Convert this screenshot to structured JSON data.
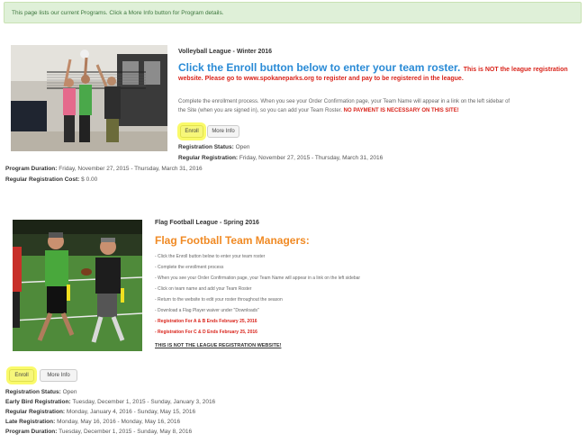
{
  "alert": "This page lists our current Programs. Click a More Info button for Program details.",
  "volleyball": {
    "title": "Volleyball League - Winter 2016",
    "headline": "Click the Enroll button below to enter your team roster.",
    "notice_part1": "This is NOT the league registration",
    "notice_part2": "website. Please go to www.spokaneparks.org to register and pay to be registered in the league.",
    "desc_line1": "Complete the enrollment process.  When you see your Order Confirmation page, your Team Name will appear in a link on the left sidebar of",
    "desc_line2": "the Site (when you are signed in), so you can add your Team Roster.",
    "desc_red": "NO PAYMENT IS NECESSARY ON THIS SITE!",
    "enroll_label": "Enroll",
    "more_info_label": "More Info",
    "status_label": "Registration Status:",
    "status_value": "Open",
    "regular_label": "Regular Registration:",
    "regular_value": "Friday, November 27, 2015 - Thursday, March 31, 2016",
    "duration_label": "Program Duration:",
    "duration_value": "Friday, November 27, 2015 - Thursday, March 31, 2016",
    "cost_label": "Regular Registration Cost:",
    "cost_value": "$ 0.00"
  },
  "flag": {
    "title": "Flag Football League - Spring 2016",
    "headline": "Flag Football Team Managers:",
    "bullets": [
      "- Click the Enroll button below to enter your team roster",
      "- Complete the enrollment process",
      "- When you see your Order Confirmation page, your Team Name will appear in a link on the left sidebar",
      "- Click on team name and add your Team Roster",
      "- Return to the website to edit your roster throughout the season",
      "- Download a Flag Player waiver under \"Downloads\""
    ],
    "red_bullets": [
      "- Registration For A & B Ends February 25, 2016",
      "- Registration For C & D Ends February 25, 2016"
    ],
    "not_site": "THIS IS NOT THE LEAGUE REGISTRATION WEBSITE!",
    "enroll_label": "Enroll",
    "more_info_label": "More Info",
    "status_label": "Registration Status:",
    "status_value": "Open",
    "early_label": "Early Bird Registration:",
    "early_value": "Tuesday, December 1, 2015 - Sunday, January 3, 2016",
    "regular_label": "Regular Registration:",
    "regular_value": "Monday, January 4, 2016 - Sunday, May 15, 2016",
    "late_label": "Late Registration:",
    "late_value": "Monday, May 16, 2016 - Monday, May 16, 2016",
    "duration_label": "Program Duration:",
    "duration_value": "Tuesday, December 1, 2015 - Sunday, May 8, 2016"
  },
  "colors": {
    "alert_bg": "#dff0d8",
    "headline_blue": "#2a8bd6",
    "notice_red": "#d9241b",
    "headline_orange": "#f08a24",
    "enroll_highlight": "#f7f77a"
  }
}
